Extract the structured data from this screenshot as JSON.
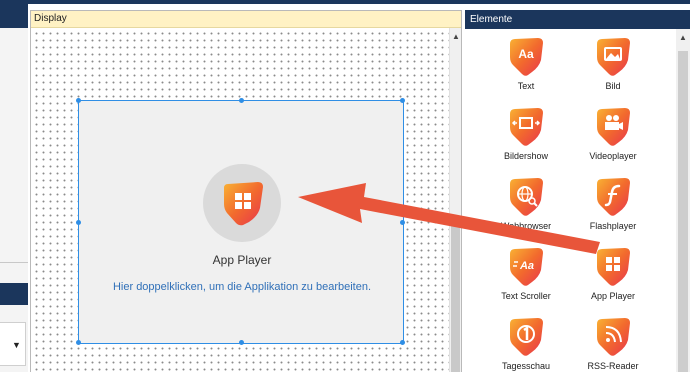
{
  "display_panel": {
    "title": "Display",
    "widget": {
      "name": "App Player",
      "hint": "Hier doppelklicken, um die Applikation zu bearbeiten.",
      "icon": "app-player-icon"
    }
  },
  "elements_panel": {
    "title": "Elemente",
    "items": [
      {
        "label": "Text",
        "icon": "text-icon"
      },
      {
        "label": "Bild",
        "icon": "image-icon"
      },
      {
        "label": "Bildershow",
        "icon": "slideshow-icon"
      },
      {
        "label": "Videoplayer",
        "icon": "video-camera-icon"
      },
      {
        "label": "Webbrowser",
        "icon": "web-globe-icon"
      },
      {
        "label": "Flashplayer",
        "icon": "flash-icon"
      },
      {
        "label": "Text Scroller",
        "icon": "text-scroller-icon"
      },
      {
        "label": "App Player",
        "icon": "app-player-icon"
      },
      {
        "label": "Tagesschau",
        "icon": "tagesschau-icon"
      },
      {
        "label": "RSS-Reader",
        "icon": "rss-icon"
      }
    ]
  },
  "colors": {
    "accent_orange": "#f26a2d",
    "accent_red": "#e8344e",
    "accent_yellow": "#f5a623",
    "selection_blue": "#2f8ee5",
    "hint_blue": "#3070b8",
    "header_navy": "#1b365c",
    "display_header": "#fff2c4",
    "arrow": "#e8553a"
  }
}
